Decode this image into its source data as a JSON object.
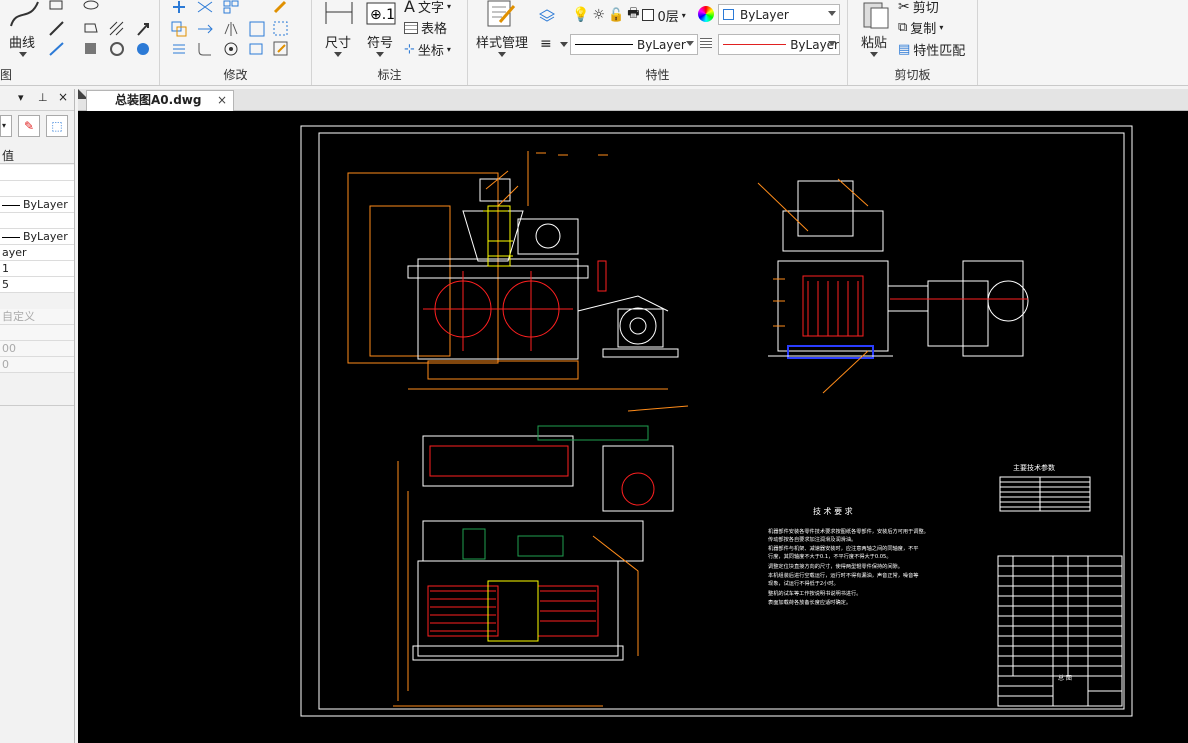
{
  "ribbon": {
    "draw_panel": {
      "curve_label": "曲线",
      "title": "图"
    },
    "modify_panel": {
      "title": "修改"
    },
    "annotation_panel": {
      "dimension_label": "尺寸",
      "symbol_label": "符号",
      "text_label": "文字",
      "table_label": "表格",
      "coordinate_label": "坐标",
      "title": "标注"
    },
    "properties_panel": {
      "style_manager_label": "样式管理",
      "layer_value": "0层",
      "color_value": "ByLayer",
      "linetype_value": "ByLayer",
      "lineweight_value": "ByLayer",
      "title": "特性"
    },
    "clipboard_panel": {
      "paste_label": "粘贴",
      "cut_label": "剪切",
      "copy_label": "复制",
      "match_label": "特性匹配",
      "title": "剪切板"
    }
  },
  "palette": {
    "header_label": "值",
    "rows": [
      "",
      "",
      "ByLayer",
      "",
      "ByLayer",
      "ayer",
      "1",
      "5"
    ],
    "grey_rows": [
      "自定义",
      "",
      "00",
      "0"
    ]
  },
  "tabs": {
    "document_tab": "总装图A0.dwg",
    "close_symbol": "×"
  },
  "drawing": {
    "main_params_title": "主要技术参数",
    "tech_req_title": "技  术  要  求",
    "tech_req_lines": [
      "机器部件安装各零件技术要求按图纸各零部件，安装后方可用于调整。",
      "传动部按各自要求加注润滑及润滑油。",
      "机器部件与机架、减速器安装时，应注意两轴之间的同轴度，不平",
      "行度，其同轴度不大于0.1，不平行度不得大于0.05。",
      "调整定位块直接方向的尺寸，使得两型辊零件保持的间隙。",
      "本机组装后进行空载运行，运行时不得有漏油，声音正常，噪音等",
      "现象，试运行不得低于2小时。",
      "整机的试车等工作按说明书说明书进行。",
      "表面加载荷各放备长度应适时确定。"
    ],
    "title_block_label": "总 图"
  },
  "colors": {
    "cad_background": "#000000",
    "orange": "#ff8c1a",
    "red": "#ff2020",
    "yellow": "#ffff00",
    "green": "#1fa050",
    "blue": "#2a3dff",
    "white": "#ffffff"
  }
}
